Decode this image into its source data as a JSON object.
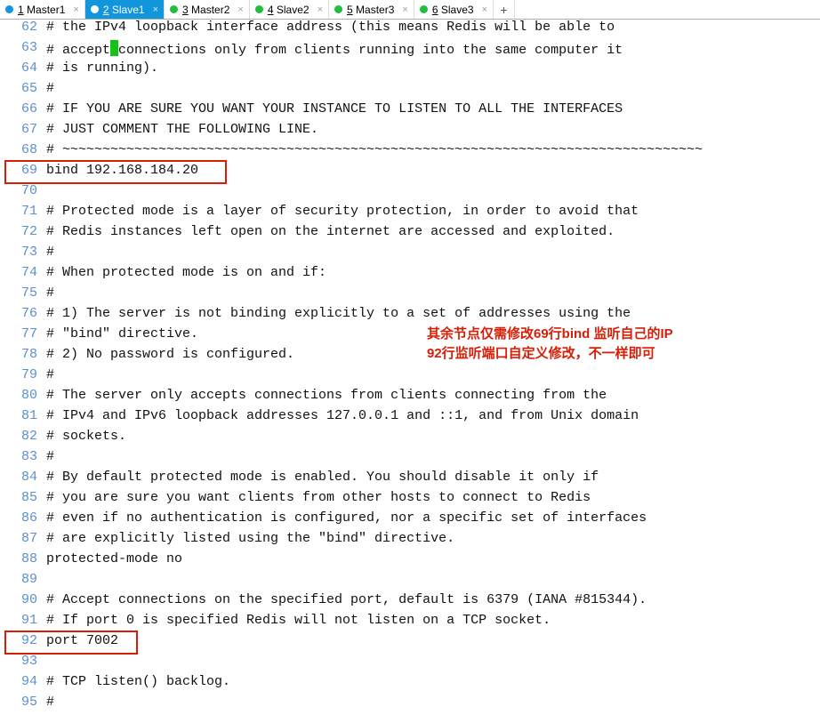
{
  "tabs": [
    {
      "index": "1",
      "label": "Master1",
      "active": false,
      "dot": "blue"
    },
    {
      "index": "2",
      "label": "Slave1",
      "active": true,
      "dot": "white"
    },
    {
      "index": "3",
      "label": "Master2",
      "active": false,
      "dot": "green"
    },
    {
      "index": "4",
      "label": "Slave2",
      "active": false,
      "dot": "green"
    },
    {
      "index": "5",
      "label": "Master3",
      "active": false,
      "dot": "green"
    },
    {
      "index": "6",
      "label": "Slave3",
      "active": false,
      "dot": "green"
    }
  ],
  "add_tab_glyph": "+",
  "close_glyph": "×",
  "lines": [
    {
      "n": 62,
      "t": "# the IPv4 loopback interface address (this means Redis will be able to"
    },
    {
      "n": 63,
      "t": "# accept",
      "cursor_after": true,
      "tail": "connections only from clients running into the same computer it"
    },
    {
      "n": 64,
      "t": "# is running)."
    },
    {
      "n": 65,
      "t": "#"
    },
    {
      "n": 66,
      "t": "# IF YOU ARE SURE YOU WANT YOUR INSTANCE TO LISTEN TO ALL THE INTERFACES"
    },
    {
      "n": 67,
      "t": "# JUST COMMENT THE FOLLOWING LINE."
    },
    {
      "n": 68,
      "t": "# ~~~~~~~~~~~~~~~~~~~~~~~~~~~~~~~~~~~~~~~~~~~~~~~~~~~~~~~~~~~~~~~~~~~~~~~~~~~~~~~~"
    },
    {
      "n": 69,
      "t": "bind 192.168.184.20"
    },
    {
      "n": 70,
      "t": ""
    },
    {
      "n": 71,
      "t": "# Protected mode is a layer of security protection, in order to avoid that"
    },
    {
      "n": 72,
      "t": "# Redis instances left open on the internet are accessed and exploited."
    },
    {
      "n": 73,
      "t": "#"
    },
    {
      "n": 74,
      "t": "# When protected mode is on and if:"
    },
    {
      "n": 75,
      "t": "#"
    },
    {
      "n": 76,
      "t": "# 1) The server is not binding explicitly to a set of addresses using the"
    },
    {
      "n": 77,
      "t": "#    \"bind\" directive."
    },
    {
      "n": 78,
      "t": "# 2) No password is configured."
    },
    {
      "n": 79,
      "t": "#"
    },
    {
      "n": 80,
      "t": "# The server only accepts connections from clients connecting from the"
    },
    {
      "n": 81,
      "t": "# IPv4 and IPv6 loopback addresses 127.0.0.1 and ::1, and from Unix domain"
    },
    {
      "n": 82,
      "t": "# sockets."
    },
    {
      "n": 83,
      "t": "#"
    },
    {
      "n": 84,
      "t": "# By default protected mode is enabled. You should disable it only if"
    },
    {
      "n": 85,
      "t": "# you are sure you want clients from other hosts to connect to Redis"
    },
    {
      "n": 86,
      "t": "# even if no authentication is configured, nor a specific set of interfaces"
    },
    {
      "n": 87,
      "t": "# are explicitly listed using the \"bind\" directive."
    },
    {
      "n": 88,
      "t": "protected-mode no"
    },
    {
      "n": 89,
      "t": ""
    },
    {
      "n": 90,
      "t": "# Accept connections on the specified port, default is 6379 (IANA #815344)."
    },
    {
      "n": 91,
      "t": "# If port 0 is specified Redis will not listen on a TCP socket."
    },
    {
      "n": 92,
      "t": "port 7002"
    },
    {
      "n": 93,
      "t": ""
    },
    {
      "n": 94,
      "t": "# TCP listen() backlog."
    },
    {
      "n": 95,
      "t": "#"
    }
  ],
  "annotation": {
    "line1": "其余节点仅需修改69行bind 监听自己的IP",
    "line2": "92行监听端口自定义修改，不一样即可"
  },
  "redboxes": {
    "box1": {
      "around_line": 69
    },
    "box2": {
      "around_line": 92
    }
  }
}
